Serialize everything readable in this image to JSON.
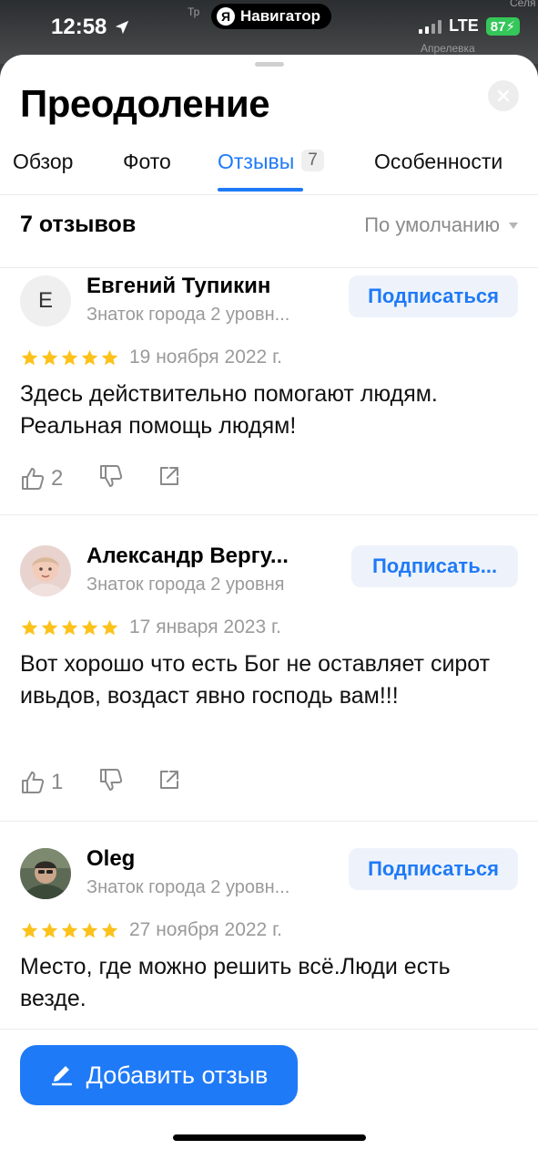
{
  "status_bar": {
    "time": "12:58",
    "navigator_label": "Навигатор",
    "network": "LTE",
    "battery": "87"
  },
  "map_labels": [
    "Тр",
    "Селя",
    "Апрелевка"
  ],
  "sheet": {
    "title": "Преодоление"
  },
  "tabs": [
    {
      "label": "Обзор",
      "active": false
    },
    {
      "label": "Фото",
      "active": false
    },
    {
      "label": "Отзывы",
      "count": "7",
      "active": true
    },
    {
      "label": "Особенности",
      "active": false
    }
  ],
  "reviews_header": {
    "count_label": "7 отзывов",
    "sort_label": "По умолчанию"
  },
  "reviews": [
    {
      "avatar_letter": "Е",
      "author": "Евгений Тупикин",
      "level": "Знаток города 2 уровн...",
      "subscribe_label": "Подписаться",
      "rating": 5,
      "date": "19 ноября 2022 г.",
      "text": "Здесь действительно помогают людям. Реальная помощь людям!",
      "likes": "2"
    },
    {
      "avatar_letter": "",
      "author": "Александр Вергу...",
      "level": "Знаток города 2 уровня",
      "subscribe_label": "Подписать...",
      "rating": 5,
      "date": "17 января 2023 г.",
      "text": "Вот хорошо что есть Бог не оставляет сирот ивьдов, воздаст явно господь вам!!!",
      "likes": "1"
    },
    {
      "avatar_letter": "",
      "author": "Oleg",
      "level": "Знаток города 2 уровн...",
      "subscribe_label": "Подписаться",
      "rating": 5,
      "date": "27 ноября 2022 г.",
      "text": "Место, где можно решить всё.Люди есть везде."
    }
  ],
  "add_review": {
    "label": "Добавить отзыв"
  },
  "colors": {
    "accent": "#1f7af7",
    "star": "#fcc21b",
    "battery": "#34c759"
  }
}
